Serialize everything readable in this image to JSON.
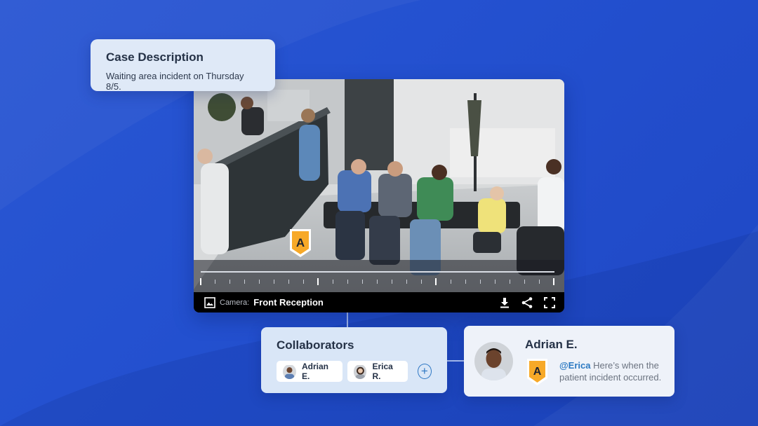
{
  "case": {
    "title": "Case Description",
    "description": "Waiting area incident on Thursday 8/5."
  },
  "video": {
    "marker_label": "A",
    "camera_label": "Camera:",
    "camera_name": "Front Reception",
    "icons": [
      "image-icon",
      "download-icon",
      "share-icon",
      "fullscreen-icon"
    ]
  },
  "collaborators": {
    "title": "Collaborators",
    "people": [
      {
        "name": "Adrian E."
      },
      {
        "name": "Erica R."
      }
    ],
    "add_symbol": "+"
  },
  "comment": {
    "author": "Adrian E.",
    "marker_label": "A",
    "mention": "@Erica",
    "text": " Here’s when the patient incident occurred."
  },
  "colors": {
    "background": "#2350cf",
    "marker": "#f7a928",
    "mention": "#2b79c2"
  }
}
